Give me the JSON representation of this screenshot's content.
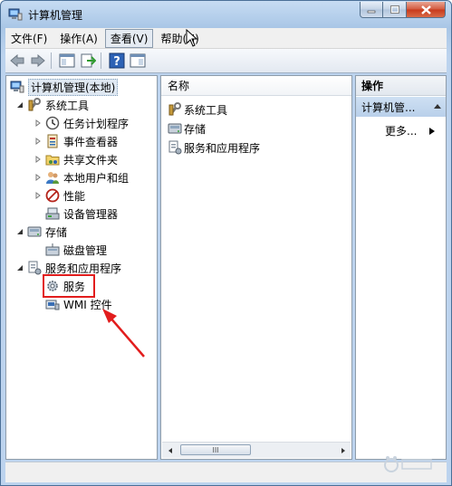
{
  "window": {
    "title": "计算机管理",
    "icon": "computer-management-icon"
  },
  "menu": [
    {
      "label": "文件(F)"
    },
    {
      "label": "操作(A)"
    },
    {
      "label": "查看(V)"
    },
    {
      "label": "帮助(H)"
    }
  ],
  "toolbar": {
    "buttons": [
      "back-arrow-icon",
      "forward-arrow-icon",
      "show-hide-tree-icon",
      "export-list-icon",
      "help-icon",
      "show-hide-action-pane-icon"
    ]
  },
  "tree": {
    "root": "计算机管理(本地)",
    "system_tools": "系统工具",
    "task_scheduler": "任务计划程序",
    "event_viewer": "事件查看器",
    "shared_folders": "共享文件夹",
    "local_users": "本地用户和组",
    "performance": "性能",
    "device_manager": "设备管理器",
    "storage": "存储",
    "disk_management": "磁盘管理",
    "services_apps": "服务和应用程序",
    "services": "服务",
    "wmi": "WMI 控件"
  },
  "center": {
    "column_name": "名称",
    "items": [
      "系统工具",
      "存储",
      "服务和应用程序"
    ],
    "scroll_thumb": "III"
  },
  "actions": {
    "header": "操作",
    "section": "计算机管...",
    "more": "更多..."
  },
  "colors": {
    "highlight_box": "#e21d1d",
    "arrow": "#e21d1d",
    "title_gradient_top": "#c7dcf3"
  }
}
